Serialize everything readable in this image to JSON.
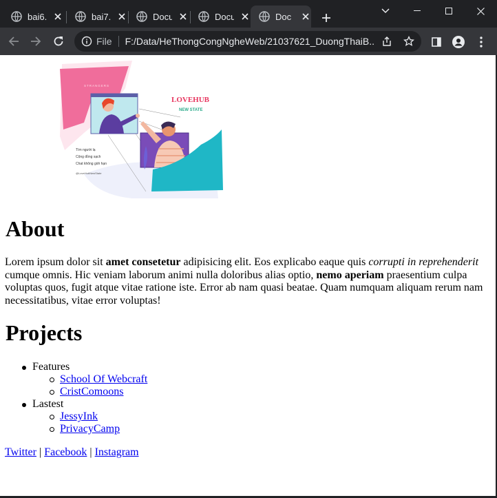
{
  "browser": {
    "tabs": [
      {
        "title": "bai6."
      },
      {
        "title": "bai7."
      },
      {
        "title": "Docu"
      },
      {
        "title": "Docu"
      },
      {
        "title": "Doc"
      }
    ],
    "omnibox": {
      "scheme_label": "File",
      "url": "F:/Data/HeThongCongNgheWeb/21037621_DuongThaiB..."
    }
  },
  "banner": {
    "tag": "STRANGERS",
    "brand": "LOVEHUB",
    "brand_sub": "NEW STATE",
    "lines": [
      "Tìm người lạ",
      "Cộng đồng sạch",
      "Chat không giới hạn"
    ],
    "handle": "@LoveHubNewState"
  },
  "about": {
    "heading": "About",
    "t1": "Lorem ipsum dolor sit ",
    "b1": "amet consetetur",
    "t2": " adipisicing elit. Eos explicabo eaque quis ",
    "i1": "corrupti in reprehenderit",
    "t3": " cumque omnis. Hic veniam laborum animi nulla doloribus alias optio, ",
    "b2": "nemo aperiam",
    "t4": " praesentium culpa voluptas quos, fugit atque vitae ratione iste. Error ab nam quasi beatae. Quam numquam aliquam rerum nam necessitatibus, vitae error voluptas!"
  },
  "projects": {
    "heading": "Projects",
    "groups": [
      {
        "label": "Features",
        "items": [
          "School Of Webcraft",
          "CristComoons"
        ]
      },
      {
        "label": "Lastest",
        "items": [
          "JessyInk",
          "PrivacyCamp"
        ]
      }
    ]
  },
  "social": {
    "links": [
      "Twitter",
      "Facebook",
      "Instagram"
    ],
    "separator": "|"
  }
}
